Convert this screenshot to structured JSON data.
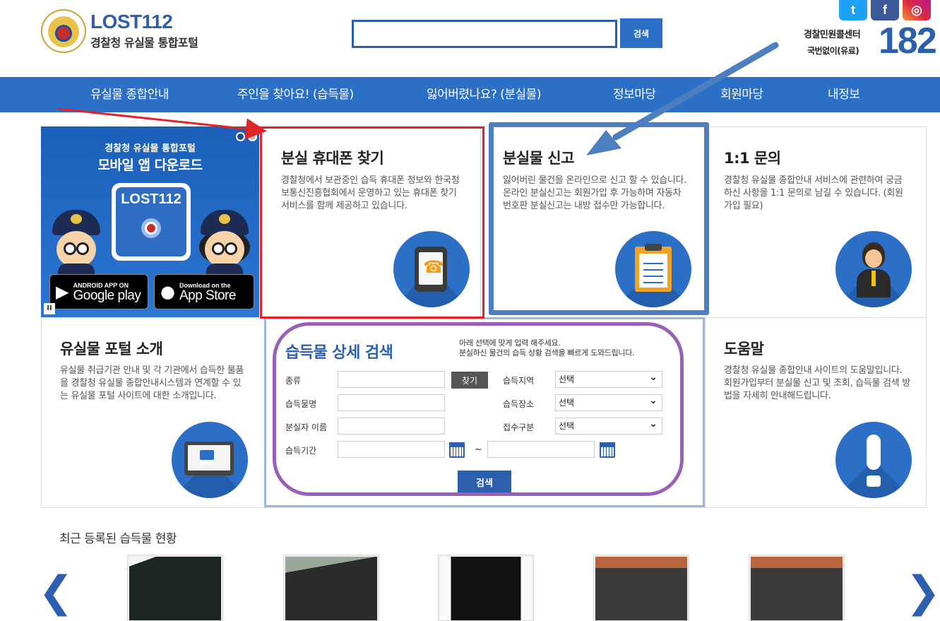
{
  "header": {
    "logo_title": "LOST112",
    "logo_subtitle": "경찰청 유실물 통합포털",
    "search_placeholder": "",
    "search_button": "검색",
    "callcenter_label": "경찰민원콜센터",
    "callcenter_sub": "국번없이(유료)",
    "callcenter_number": "182",
    "social": [
      "twitter-icon",
      "facebook-icon",
      "instagram-icon"
    ]
  },
  "nav": {
    "items": [
      "유실물 종합안내",
      "주인을 찾아요! (습득물)",
      "잃어버렸나요? (분실물)",
      "정보마당",
      "회원마당",
      "내정보"
    ]
  },
  "banner": {
    "line1": "경찰청 유실물 통합포털",
    "line2": "모바일 앱 다운로드",
    "tablet_text": "LOST112",
    "google_small": "ANDROID APP ON",
    "google_big": "Google play",
    "apple_small": "Download on the",
    "apple_big": "App Store",
    "pause": "II"
  },
  "cards": {
    "phone": {
      "title": "분실 휴대폰 찾기",
      "desc": "경찰청에서 보관중인 습득 휴대폰 정보와 한국정보통신진흥협회에서 운영하고 있는 휴대폰 찾기 서비스를 함께 제공하고 있습니다."
    },
    "report": {
      "title": "분실물 신고",
      "desc": "잃어버린 물건을 온라인으로 신고 할 수 있습니다. 온라인 분실신고는 회원가입 후 가능하며 자동차 번호판 분실신고는 내방 접수만 가능합니다."
    },
    "inquiry": {
      "title": "1:1 문의",
      "desc": "경찰청 유실물 종합안내 서비스에 관련하여 궁금하신 사항을 1:1 문의로 남길 수 있습니다. (회원가입 필요)"
    },
    "intro": {
      "title": "유실물 포털 소개",
      "desc": "유실물 취급기관 안내 및 각 기관에서 습득한 물품을 경찰청 유실물 종합안내시스템과 연계할 수 있는 유실물 포털 사이트에 대한 소개입니다."
    },
    "help": {
      "title": "도움말",
      "desc": "경찰청 유실물 종합안내 사이트의 도움말입니다. 회원가입부터 분실물 신고 및 조회, 습득물 검색 방법을 자세히 안내해드립니다."
    }
  },
  "search_form": {
    "title": "습득물 상세 검색",
    "note_line1": "아래 선택에 맞게 입력 해주세요.",
    "note_line2": "분실하신 물건의 습득 상황 검색을 빠르게 도와드립니다.",
    "label_type": "종류",
    "find_button": "찾기",
    "label_name": "습득물명",
    "label_owner": "분실자 이름",
    "label_period": "습득기간",
    "tilde": "~",
    "label_region": "습득지역",
    "label_place": "습득장소",
    "label_category": "접수구분",
    "select_default": "선택",
    "submit": "검색"
  },
  "recent": {
    "title": "최근 등록된 습득물 현황",
    "prev": "❮",
    "next": "❯"
  }
}
